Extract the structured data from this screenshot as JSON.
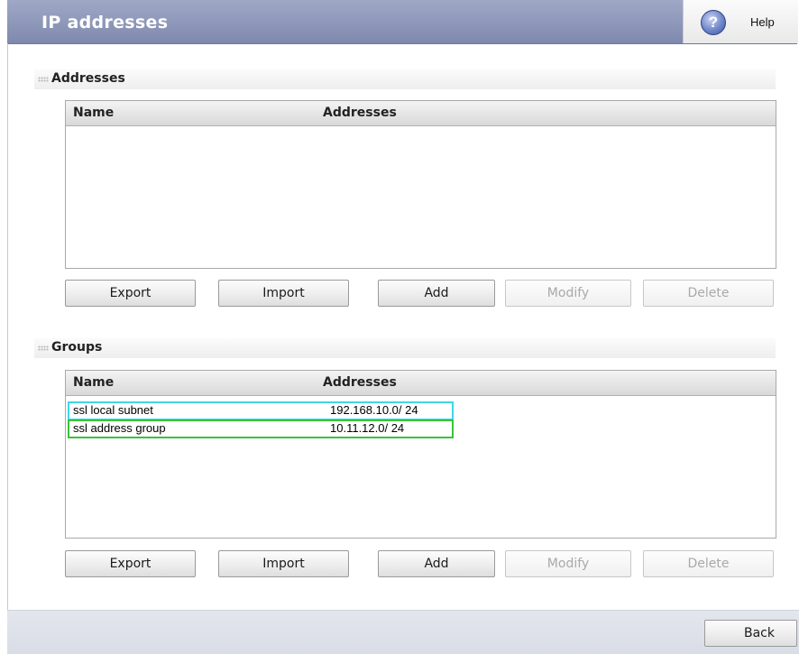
{
  "header": {
    "title": "IP addresses",
    "help_label": "Help",
    "help_icon": "question-circle-icon"
  },
  "addresses_section": {
    "title": "Addresses",
    "columns": [
      "Name",
      "Addresses"
    ],
    "rows": [],
    "buttons": {
      "export": "Export",
      "import": "Import",
      "add": "Add",
      "modify": "Modify",
      "delete": "Delete"
    }
  },
  "groups_section": {
    "title": "Groups",
    "columns": [
      "Name",
      "Addresses"
    ],
    "rows": [
      {
        "name": "ssl local subnet",
        "addresses": "192.168.10.0/ 24",
        "highlight_color": "#3fd7e6"
      },
      {
        "name": "ssl address group",
        "addresses": "10.11.12.0/ 24",
        "highlight_color": "#39c23c"
      }
    ],
    "buttons": {
      "export": "Export",
      "import": "Import",
      "add": "Add",
      "modify": "Modify",
      "delete": "Delete"
    }
  },
  "footer": {
    "back_label": "Back"
  },
  "colors": {
    "header_bg": "#8b94b7",
    "footer_bg": "#dee1e9",
    "disabled_text": "#a9a9a9"
  }
}
